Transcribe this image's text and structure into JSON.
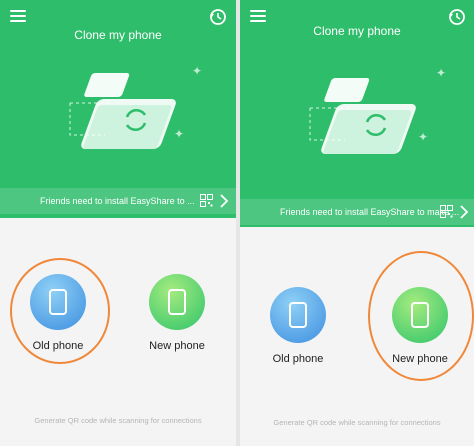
{
  "left": {
    "title": "Clone my phone",
    "banner_text": "Friends need to install EasyShare to ...",
    "old_phone_label": "Old phone",
    "new_phone_label": "New phone",
    "footer_text": "Generate QR code while scanning for connections",
    "highlighted": "Old phone"
  },
  "right": {
    "title": "Clone my phone",
    "banner_text": "Friends need to install EasyShare to make ...",
    "old_phone_label": "Old phone",
    "new_phone_label": "New phone",
    "footer_text": "Generate QR code while scanning for connections",
    "highlighted": "New phone"
  },
  "icons": {
    "menu": "menu-icon",
    "history": "history-icon",
    "qr": "qr-code-icon",
    "chevron": "chevron-right-icon",
    "phone": "phone-icon",
    "sync": "sync-icon"
  },
  "colors": {
    "header_green": "#2ebd6b",
    "old_phone_blue": "#3d8ee0",
    "new_phone_green": "#2fc46a",
    "highlight_ring": "#f0883a",
    "background": "#f4f4f4"
  }
}
